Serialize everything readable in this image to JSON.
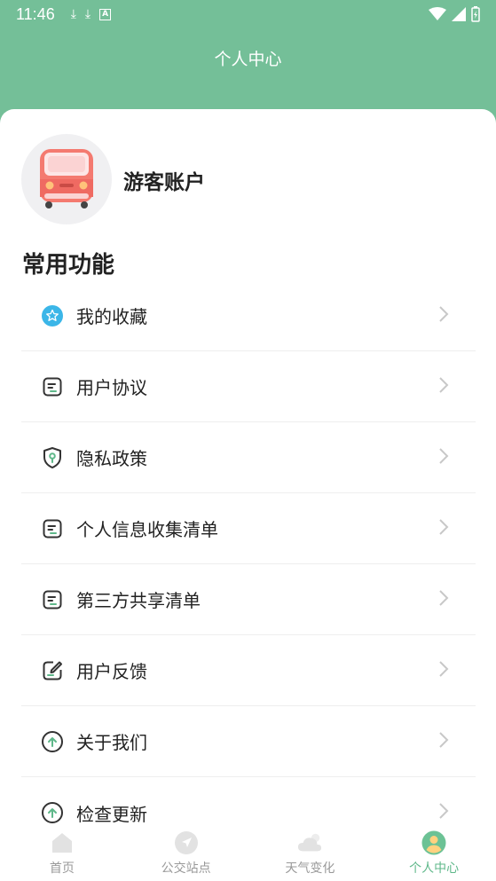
{
  "status_bar": {
    "time": "11:46"
  },
  "header": {
    "title": "个人中心"
  },
  "profile": {
    "name": "游客账户"
  },
  "section": {
    "title": "常用功能"
  },
  "menu": [
    {
      "label": "我的收藏",
      "icon": "star-icon"
    },
    {
      "label": "用户协议",
      "icon": "document-icon"
    },
    {
      "label": "隐私政策",
      "icon": "shield-icon"
    },
    {
      "label": "个人信息收集清单",
      "icon": "document-icon"
    },
    {
      "label": "第三方共享清单",
      "icon": "document-icon"
    },
    {
      "label": "用户反馈",
      "icon": "edit-icon"
    },
    {
      "label": "关于我们",
      "icon": "arrow-up-circle-icon"
    },
    {
      "label": "检查更新",
      "icon": "arrow-up-circle-icon"
    }
  ],
  "tabbar": {
    "tabs": [
      {
        "label": "首页",
        "icon": "home-icon"
      },
      {
        "label": "公交站点",
        "icon": "navigation-icon"
      },
      {
        "label": "天气变化",
        "icon": "cloud-icon"
      },
      {
        "label": "个人中心",
        "icon": "user-icon"
      }
    ],
    "active_index": 3
  },
  "colors": {
    "header": "#74bf98",
    "accent": "#5fb88a",
    "star": "#3bb6e8"
  }
}
